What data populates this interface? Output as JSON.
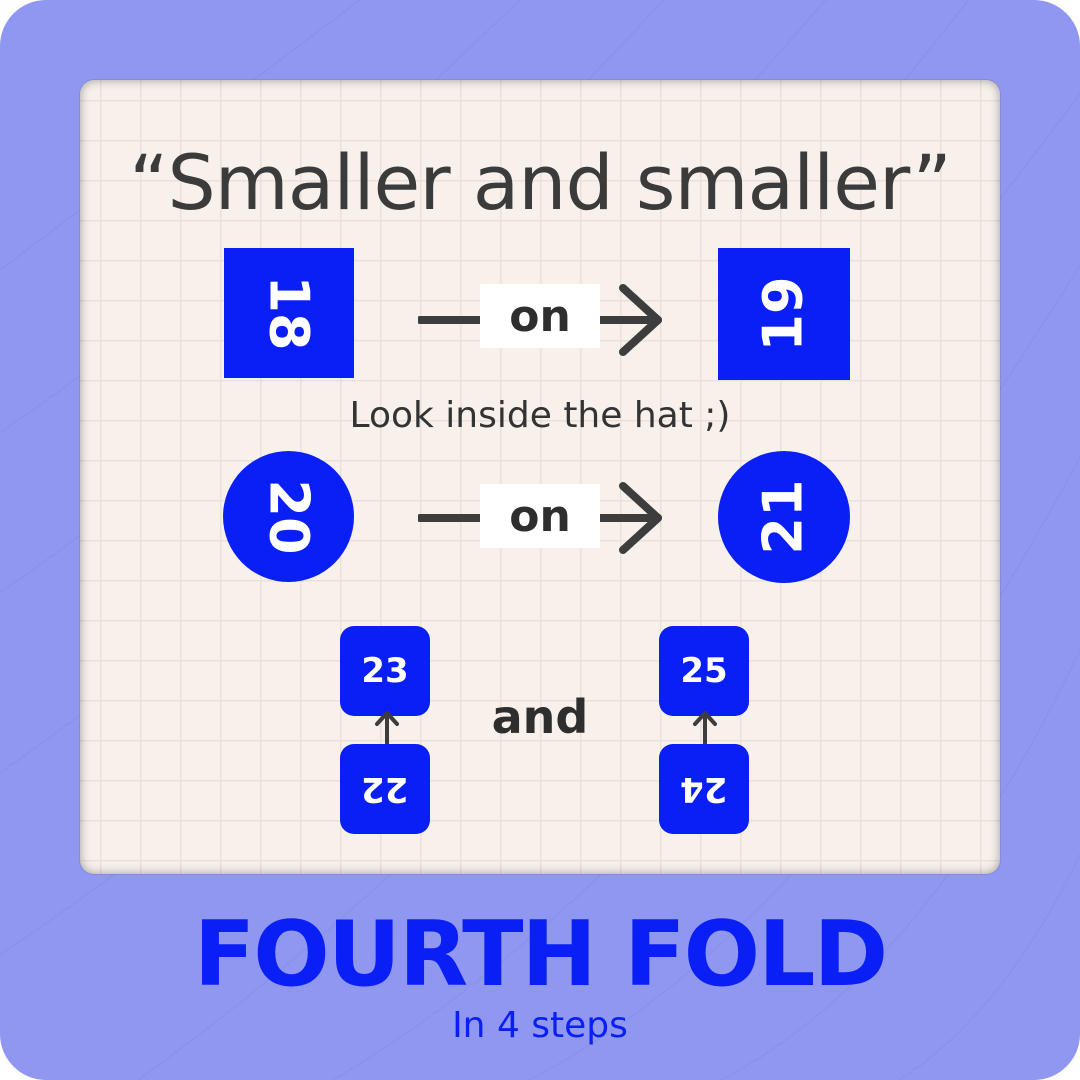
{
  "colors": {
    "frame": "#8f97f0",
    "card": "#f7f0eb",
    "accent": "#0a1ff5",
    "text": "#3b3b3b"
  },
  "headline": "“Smaller and smaller”",
  "row1": {
    "from_number": "18",
    "connector_label": "on",
    "to_number": "19"
  },
  "caption": "Look inside the hat ;)",
  "row2": {
    "from_number": "20",
    "connector_label": "on",
    "to_number": "21"
  },
  "row3": {
    "left_top": "23",
    "left_bottom": "22",
    "joiner": "and",
    "right_top": "25",
    "right_bottom": "24"
  },
  "footer": {
    "title": "FOURTH FOLD",
    "subtitle": "In 4 steps"
  }
}
